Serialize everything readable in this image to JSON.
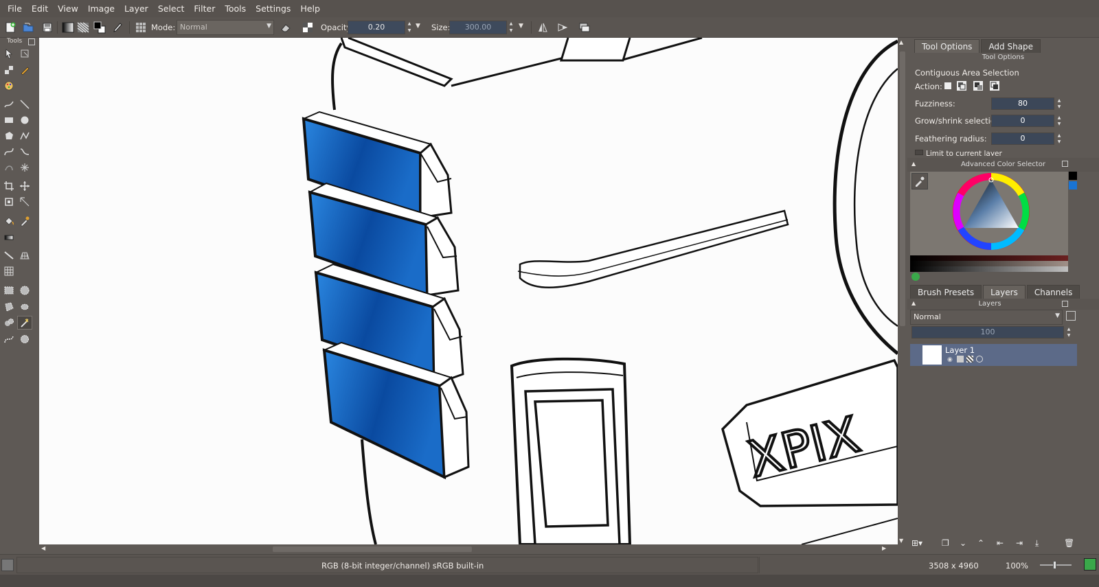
{
  "menu": [
    "File",
    "Edit",
    "View",
    "Image",
    "Layer",
    "Select",
    "Filter",
    "Tools",
    "Settings",
    "Help"
  ],
  "toolbar": {
    "mode_label": "Mode:",
    "mode_value": "Normal",
    "opacity_label": "Opacity:",
    "opacity_value": "0.20",
    "size_label": "Size:",
    "size_value": "300.00"
  },
  "tools_panel": {
    "title": "Tools"
  },
  "tool_options": {
    "tabs": [
      "Tool Options",
      "Add Shape"
    ],
    "header": "Tool Options",
    "title": "Contiguous Area Selection",
    "action_label": "Action:",
    "fuzziness_label": "Fuzziness:",
    "fuzziness_value": "80",
    "grow_label": "Grow/shrink selection:",
    "grow_value": "0",
    "feather_label": "Feathering radius:",
    "feather_value": "0",
    "limit_label": "Limit to current layer"
  },
  "color_selector": {
    "header": "Advanced Color Selector"
  },
  "layers_panel": {
    "tabs": [
      "Brush Presets",
      "Layers",
      "Channels"
    ],
    "header": "Layers",
    "blend_mode": "Normal",
    "opacity": "100",
    "layers": [
      {
        "name": "Layer 1"
      }
    ]
  },
  "canvas": {
    "logo_text": "XPIX"
  },
  "status": {
    "color_info": "RGB (8-bit integer/channel)  sRGB built-in",
    "dimensions": "3508 x 4960",
    "zoom": "100%"
  },
  "colors": {
    "menubar": "#57524e",
    "panel": "#5e5955",
    "accent_blue": "#1a74d4",
    "selection": "#5c6a88"
  }
}
